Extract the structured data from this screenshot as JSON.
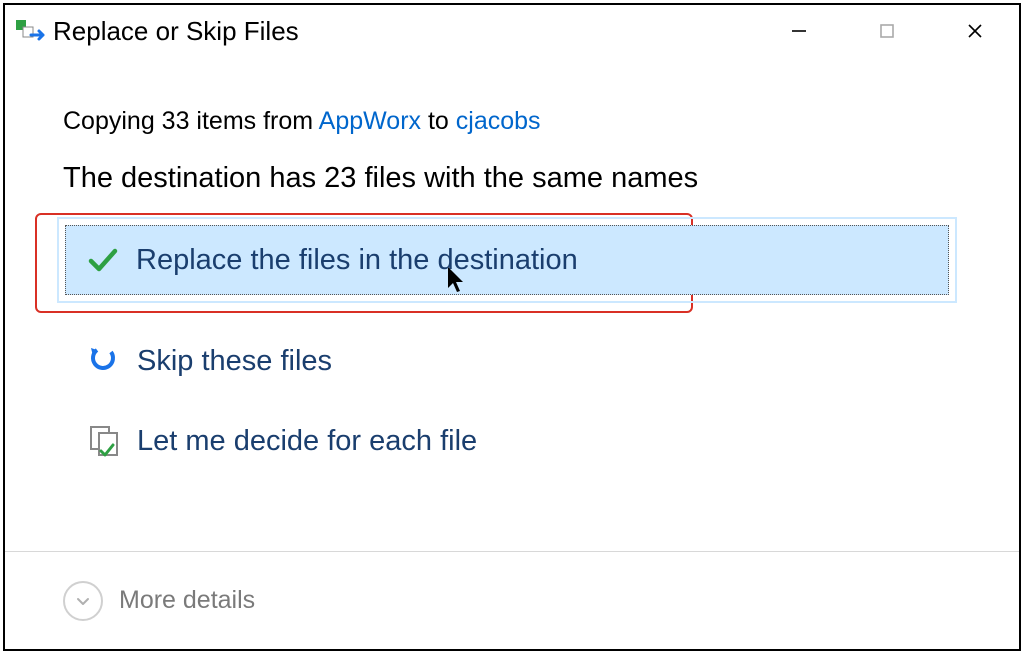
{
  "titlebar": {
    "title": "Replace or Skip Files"
  },
  "status": {
    "prefix": "Copying 33 items from ",
    "source": "AppWorx",
    "mid": " to ",
    "dest": "cjacobs"
  },
  "conflict": {
    "message": "The destination has 23 files with the same names"
  },
  "options": {
    "replace": "Replace the files in the destination",
    "skip": "Skip these files",
    "decide": "Let me decide for each file"
  },
  "footer": {
    "more": "More details"
  }
}
